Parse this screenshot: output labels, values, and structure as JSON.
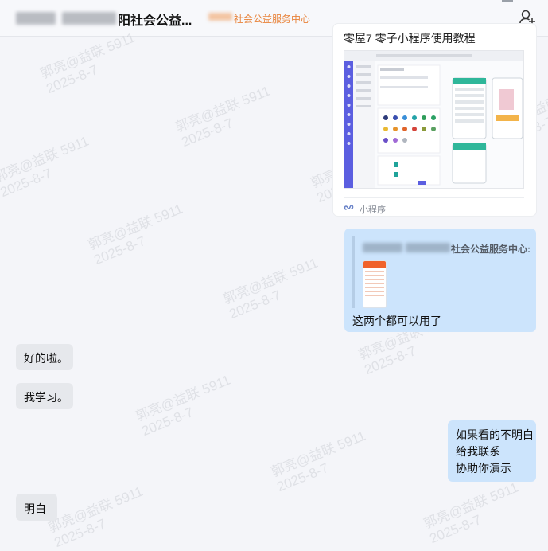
{
  "header": {
    "title": "阳社会公益...",
    "subtitle": "社会公益服务中心"
  },
  "watermark": {
    "line1": "郭亮@益联 5911",
    "line2": "2025-8-7"
  },
  "messages": {
    "mini_program": {
      "title": "零屋7 零子小程序使用教程",
      "label": "小程序"
    },
    "reply": {
      "quoted_author": "社会公益服务中心:",
      "text": "这两个都可以用了"
    },
    "left_1": "好的啦。",
    "left_2": "我学习。",
    "right_multi": {
      "line1": "如果看的不明白",
      "line2": "给我联系",
      "line3": "协助你演示"
    },
    "left_3": "明白"
  },
  "icons": {
    "add_member": "add-person-icon",
    "mini_program": "mini-program-icon"
  },
  "colors": {
    "accent_orange": "#e8833a",
    "bubble_self": "#cce4fc",
    "bubble_other": "#e6e8ec"
  }
}
